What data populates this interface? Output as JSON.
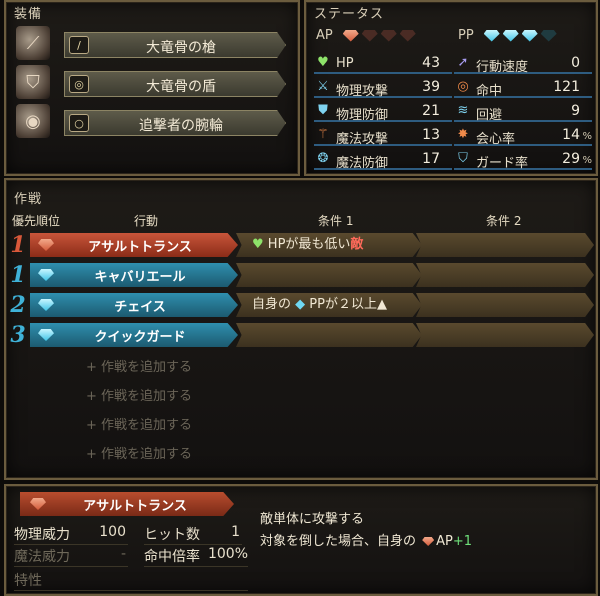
{
  "equipment": {
    "title": "装備",
    "items": [
      {
        "kind_icon": "/",
        "name": "大竜骨の槍",
        "icon": "spear-icon",
        "glyph": "⟋"
      },
      {
        "kind_icon": "◎",
        "name": "大竜骨の盾",
        "icon": "shield-icon",
        "glyph": "⛉"
      },
      {
        "kind_icon": "○",
        "name": "追撃者の腕輪",
        "icon": "bracelet-icon",
        "glyph": "◉"
      }
    ]
  },
  "status": {
    "title": "ステータス",
    "ap_label": "AP",
    "ap_total": 4,
    "ap_filled": 1,
    "pp_label": "PP",
    "pp_total": 4,
    "pp_filled": 3,
    "stats_left": [
      {
        "icon": "heart-icon",
        "glyph": "♥",
        "color": "#8ee36a",
        "label": "HP",
        "value": "43"
      },
      {
        "icon": "sword-icon",
        "glyph": "⚔",
        "color": "#7fd3f0",
        "label": "物理攻撃",
        "value": "39"
      },
      {
        "icon": "armor-icon",
        "glyph": "⛊",
        "color": "#7fd3f0",
        "label": "物理防御",
        "value": "21"
      },
      {
        "icon": "staff-icon",
        "glyph": "⚚",
        "color": "#f08a4a",
        "label": "魔法攻撃",
        "value": "13"
      },
      {
        "icon": "magic-defense-icon",
        "glyph": "❂",
        "color": "#7fd3f0",
        "label": "魔法防御",
        "value": "17"
      }
    ],
    "stats_right": [
      {
        "icon": "speed-icon",
        "glyph": "➚",
        "color": "#a89cf0",
        "label": "行動速度",
        "value": "0",
        "pct": ""
      },
      {
        "icon": "target-icon",
        "glyph": "◎",
        "color": "#f08a4a",
        "label": "命中",
        "value": "121",
        "pct": ""
      },
      {
        "icon": "evade-icon",
        "glyph": "≋",
        "color": "#7fd3f0",
        "label": "回避",
        "value": "9",
        "pct": ""
      },
      {
        "icon": "critical-icon",
        "glyph": "✸",
        "color": "#f08a4a",
        "label": "会心率",
        "value": "14",
        "pct": "%"
      },
      {
        "icon": "guard-icon",
        "glyph": "⛉",
        "color": "#7fd3f0",
        "label": "ガード率",
        "value": "29",
        "pct": "%"
      }
    ]
  },
  "tactics": {
    "title": "作戦",
    "headers": {
      "priority": "優先順位",
      "action": "行動",
      "cond1": "条件 1",
      "cond2": "条件 2"
    },
    "rows": [
      {
        "priority": "1",
        "prio_color": "#d9583a",
        "gem": "ap",
        "action": "アサルトトランス",
        "bg": "linear-gradient(180deg,#c8553a,#8b2c18)",
        "cond1": "HPが最も低い",
        "cond1_icon": "♥",
        "cond1_suffix": "敵",
        "cond1_ctype": "hp",
        "cond2": ""
      },
      {
        "priority": "1",
        "prio_color": "#3fb2d8",
        "gem": "pp",
        "action": "キャバリエール",
        "bg": "linear-gradient(180deg,#2f8fae,#1c5a70)",
        "cond1": "",
        "cond1_icon": "",
        "cond1_suffix": "",
        "cond1_ctype": "",
        "cond2": ""
      },
      {
        "priority": "2",
        "prio_color": "#3fb2d8",
        "gem": "pp",
        "action": "チェイス",
        "bg": "linear-gradient(180deg,#2f8fae,#1c5a70)",
        "cond1": "自身の",
        "cond1_icon": "◆",
        "cond1_suffix": "PPが２以上▲",
        "cond1_ctype": "pp",
        "cond2": ""
      },
      {
        "priority": "3",
        "prio_color": "#3fb2d8",
        "gem": "pp",
        "action": "クイックガード",
        "bg": "linear-gradient(180deg,#2f8fae,#1c5a70)",
        "cond1": "",
        "cond1_icon": "",
        "cond1_suffix": "",
        "cond1_ctype": "",
        "cond2": ""
      }
    ],
    "add_label": "+ 作戦を追加する",
    "add_count": 4
  },
  "detail": {
    "skill_name": "アサルトトランス",
    "phys_power_label": "物理威力",
    "phys_power": "100",
    "hits_label": "ヒット数",
    "hits": "1",
    "mag_power_label": "魔法威力",
    "mag_power": "-",
    "acc_label": "命中倍率",
    "acc": "100%",
    "trait_label": "特性",
    "desc1": "敵単体に攻撃する",
    "desc2_prefix": "対象を倒した場合、自身の",
    "desc2_res": "AP",
    "desc2_gain": "+1"
  }
}
